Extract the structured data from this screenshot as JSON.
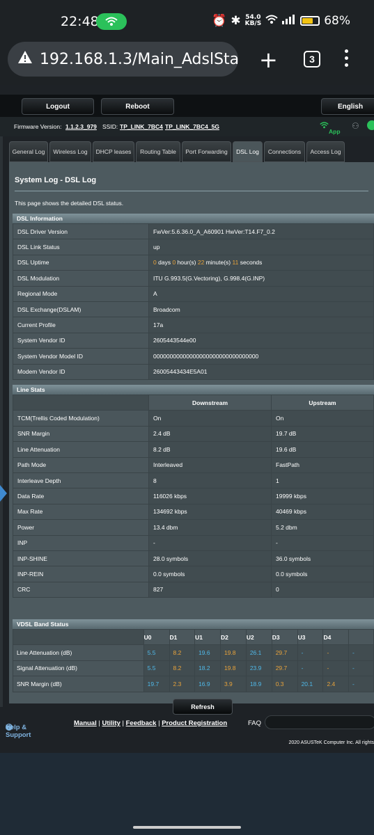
{
  "status_bar": {
    "time": "22:48",
    "speed_value": "54.0",
    "speed_unit": "KB/S",
    "battery": "68%",
    "battery_level": 0.68
  },
  "browser": {
    "url": "192.168.1.3/Main_AdslStatus_",
    "tab_count": "3"
  },
  "router": {
    "top_buttons": {
      "logout": "Logout",
      "reboot": "Reboot",
      "language": "English"
    },
    "firmware_label": "Firmware Version:",
    "firmware_value": "1.1.2.3_979",
    "ssid_label": "SSID:",
    "ssid_1": "TP_LINK_7BC4",
    "ssid_2": "TP_LINK_7BC4_5G",
    "app_label": "App",
    "tabs": [
      "General Log",
      "Wireless Log",
      "DHCP leases",
      "Routing Table",
      "Port Forwarding",
      "DSL Log",
      "Connections",
      "Access Log"
    ],
    "active_tab": "DSL Log",
    "title": "System Log - DSL Log",
    "description": "This page shows the detailed DSL status.",
    "dsl_info": {
      "header": "DSL Information",
      "rows": [
        {
          "label": "DSL Driver Version",
          "value": "FwVer:5.6.36.0_A_A60901 HwVer:T14.F7_0.2"
        },
        {
          "label": "DSL Link Status",
          "value": "up"
        },
        {
          "label": "DSL Uptime",
          "value": ""
        },
        {
          "label": "DSL Modulation",
          "value": "ITU G.993.5(G.Vectoring), G.998.4(G.INP)"
        },
        {
          "label": "Regional Mode",
          "value": "A"
        },
        {
          "label": "DSL Exchange(DSLAM)",
          "value": "Broadcom"
        },
        {
          "label": "Current Profile",
          "value": "17a"
        },
        {
          "label": "System Vendor ID",
          "value": "2605443544e00"
        },
        {
          "label": "System Vendor Model ID",
          "value": "00000000000000000000000000000000"
        },
        {
          "label": "Modem Vendor ID",
          "value": "26005443434E5A01"
        }
      ],
      "uptime": {
        "days": "0",
        "days_label": "days",
        "hours": "0",
        "hours_label": "hour(s)",
        "minutes": "22",
        "minutes_label": "minute(s)",
        "seconds": "11",
        "seconds_label": "seconds"
      }
    },
    "line_stats": {
      "header": "Line Stats",
      "col_downstream": "Downstream",
      "col_upstream": "Upstream",
      "rows": [
        {
          "label": "TCM(Trellis Coded Modulation)",
          "down": "On",
          "up": "On"
        },
        {
          "label": "SNR Margin",
          "down": "2.4 dB",
          "up": "19.7 dB"
        },
        {
          "label": "Line Attenuation",
          "down": "8.2 dB",
          "up": "19.6 dB"
        },
        {
          "label": "Path Mode",
          "down": "Interleaved",
          "up": "FastPath"
        },
        {
          "label": "Interleave Depth",
          "down": "8",
          "up": "1"
        },
        {
          "label": "Data Rate",
          "down": "116026 kbps",
          "up": "19999 kbps"
        },
        {
          "label": "Max Rate",
          "down": "134692 kbps",
          "up": "40469 kbps"
        },
        {
          "label": "Power",
          "down": "13.4 dbm",
          "up": "5.2 dbm"
        },
        {
          "label": "INP",
          "down": "-",
          "up": "-"
        },
        {
          "label": "INP-SHINE",
          "down": "28.0 symbols",
          "up": "36.0 symbols"
        },
        {
          "label": "INP-REIN",
          "down": "0.0 symbols",
          "up": "0.0 symbols"
        },
        {
          "label": "CRC",
          "down": "827",
          "up": "0"
        }
      ]
    },
    "vdsl_band": {
      "header": "VDSL Band Status",
      "columns": [
        "U0",
        "D1",
        "U1",
        "D2",
        "U2",
        "D3",
        "U3",
        "D4"
      ],
      "rows": [
        {
          "label": "Line Attenuation (dB)",
          "values": [
            "5.5",
            "8.2",
            "19.6",
            "19.8",
            "26.1",
            "29.7",
            "-",
            "-",
            "-"
          ]
        },
        {
          "label": "Signal Attenuation (dB)",
          "values": [
            "5.5",
            "8.2",
            "18.2",
            "19.8",
            "23.9",
            "29.7",
            "-",
            "-",
            "-"
          ]
        },
        {
          "label": "SNR Margin (dB)",
          "values": [
            "19.7",
            "2.3",
            "16.9",
            "3.9",
            "18.9",
            "0.3",
            "20.1",
            "2.4",
            "-"
          ]
        }
      ]
    },
    "refresh_label": "Refresh",
    "footer": {
      "help": "Help & Support",
      "manual": "Manual",
      "utility": "Utility",
      "feedback": "Feedback",
      "registration": "Product Registration",
      "faq": "FAQ",
      "copyright": "2020 ASUSTeK Computer Inc. All rights"
    }
  },
  "colors": {
    "upstream": "#4fb8e8",
    "downstream": "#e8a33b",
    "accent_green": "#2bc15a"
  }
}
